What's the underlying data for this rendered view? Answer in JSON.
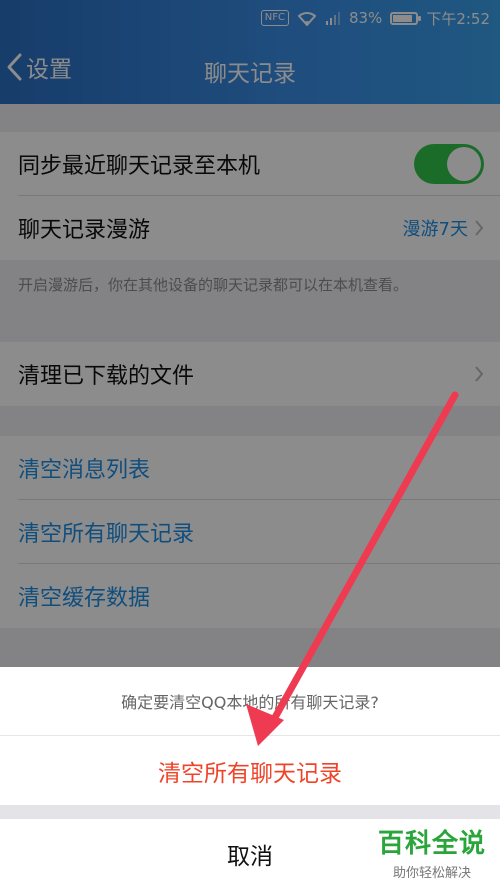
{
  "status_bar": {
    "nfc": "NFC",
    "battery": "83%",
    "time": "下午2:52",
    "battery_level": 0.83
  },
  "nav": {
    "back_label": "设置",
    "title": "聊天记录"
  },
  "settings": {
    "sync_label": "同步最近聊天记录至本机",
    "sync_enabled": true,
    "roaming_label": "聊天记录漫游",
    "roaming_value": "漫游7天",
    "roaming_hint": "开启漫游后，你在其他设备的聊天记录都可以在本机查看。",
    "clean_files_label": "清理已下载的文件",
    "clear_message_list": "清空消息列表",
    "clear_all_chat": "清空所有聊天记录",
    "clear_cache": "清空缓存数据"
  },
  "dialog": {
    "message": "确定要清空QQ本地的所有聊天记录?",
    "confirm": "清空所有聊天记录",
    "cancel": "取消"
  },
  "watermark": {
    "title": "百科全说",
    "subtitle": "助你轻松解决"
  },
  "colors": {
    "accent_blue": "#1e8fe6",
    "toggle_green": "#33c54b",
    "danger_red": "#f0442a",
    "arrow_red": "#ee3b52",
    "watermark_green": "#29a53a"
  }
}
